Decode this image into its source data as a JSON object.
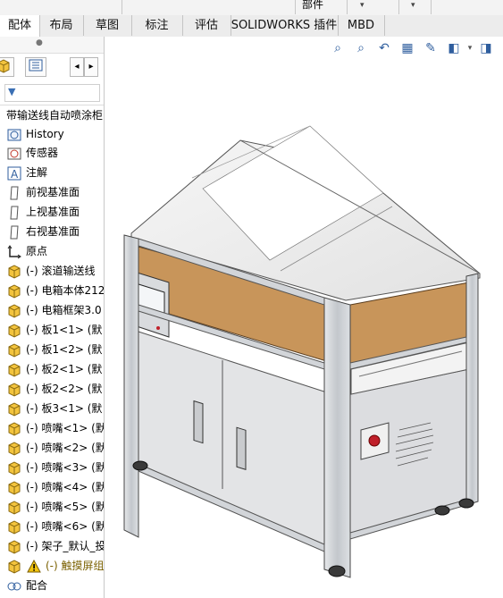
{
  "topbar": {
    "label": "部件"
  },
  "tabs": [
    {
      "label": "配体",
      "active": true
    },
    {
      "label": "布局",
      "active": false
    },
    {
      "label": "草图",
      "active": false
    },
    {
      "label": "标注",
      "active": false
    },
    {
      "label": "评估",
      "active": false
    },
    {
      "label": "SOLIDWORKS 插件",
      "active": false
    },
    {
      "label": "MBD",
      "active": false
    }
  ],
  "tree": {
    "root": "带输送线自动喷涂柜",
    "items": [
      {
        "label": "History",
        "icon": "history-icon"
      },
      {
        "label": "传感器",
        "icon": "sensor-icon"
      },
      {
        "label": "注解",
        "icon": "annotation-icon"
      },
      {
        "label": "前视基准面",
        "icon": "plane-icon"
      },
      {
        "label": "上视基准面",
        "icon": "plane-icon"
      },
      {
        "label": "右视基准面",
        "icon": "plane-icon"
      },
      {
        "label": "原点",
        "icon": "origin-icon"
      },
      {
        "label": "(-) 滚道输送线",
        "icon": "component-icon"
      },
      {
        "label": "(-) 电箱本体212",
        "icon": "component-icon"
      },
      {
        "label": "(-) 电箱框架3.0",
        "icon": "component-icon"
      },
      {
        "label": "(-) 板1<1> (默",
        "icon": "component-icon"
      },
      {
        "label": "(-) 板1<2> (默",
        "icon": "component-icon"
      },
      {
        "label": "(-) 板2<1> (默",
        "icon": "component-icon"
      },
      {
        "label": "(-) 板2<2> (默",
        "icon": "component-icon"
      },
      {
        "label": "(-) 板3<1> (默",
        "icon": "component-icon"
      },
      {
        "label": "(-) 喷嘴<1> (默",
        "icon": "component-icon"
      },
      {
        "label": "(-) 喷嘴<2> (默",
        "icon": "component-icon"
      },
      {
        "label": "(-) 喷嘴<3> (默",
        "icon": "component-icon"
      },
      {
        "label": "(-) 喷嘴<4> (默",
        "icon": "component-icon"
      },
      {
        "label": "(-) 喷嘴<5> (默",
        "icon": "component-icon"
      },
      {
        "label": "(-) 喷嘴<6> (默",
        "icon": "component-icon"
      },
      {
        "label": "(-) 架子_默认_投",
        "icon": "component-icon"
      },
      {
        "label": "(-) 触摸屏组",
        "icon": "warning-icon"
      },
      {
        "label": "配合",
        "icon": "mates-icon"
      }
    ]
  },
  "colors": {
    "accent": "#2f5e9e",
    "wood": "#c8955a",
    "frame": "#c9cdd2",
    "warning": "#f2c40f"
  }
}
